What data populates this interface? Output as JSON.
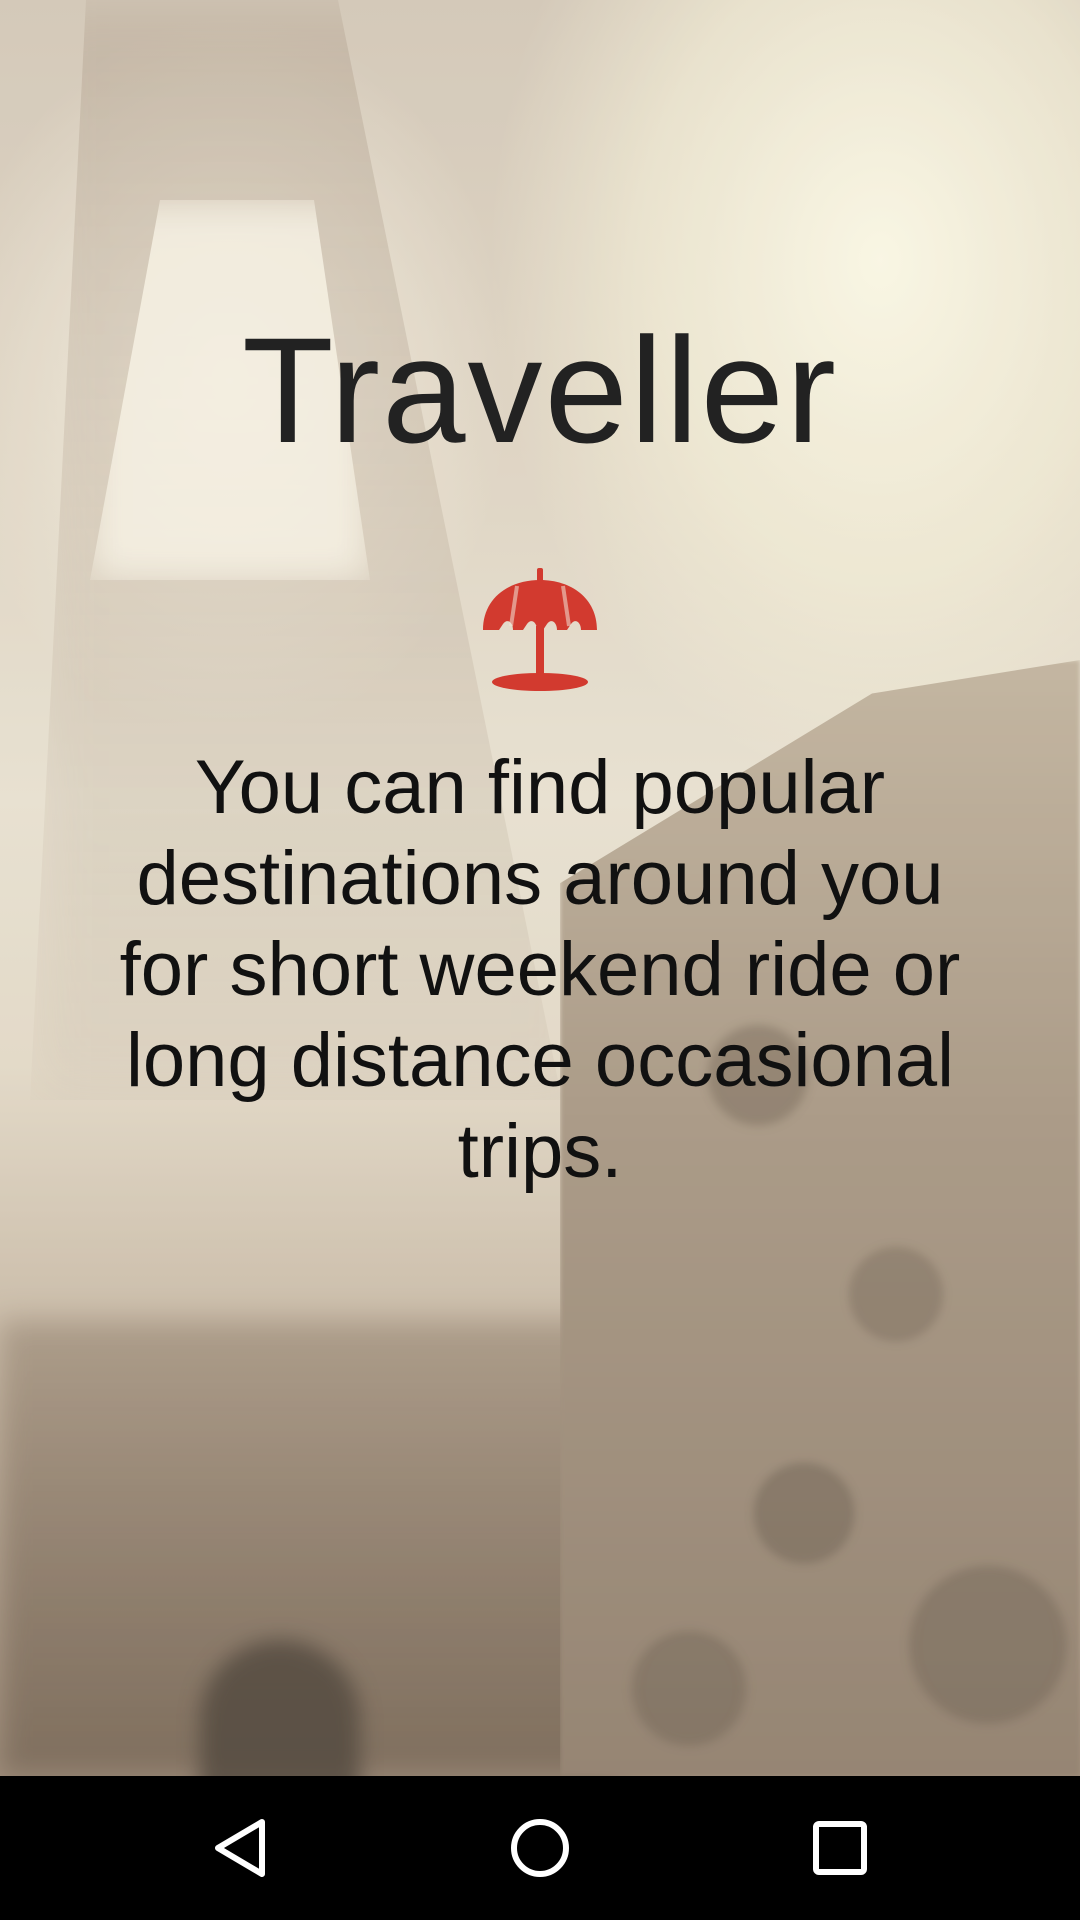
{
  "app": {
    "title": "Traveller"
  },
  "onboarding": {
    "icon": "beach-umbrella-icon",
    "description": "You can find popular destinations around you for short weekend ride or long distance occasional trips."
  },
  "colors": {
    "accent": "#d23a2f",
    "title_text": "#222222",
    "body_text": "#111111",
    "navbar": "#000000"
  },
  "navbar": {
    "buttons": [
      "back-icon",
      "home-icon",
      "recents-icon"
    ]
  }
}
